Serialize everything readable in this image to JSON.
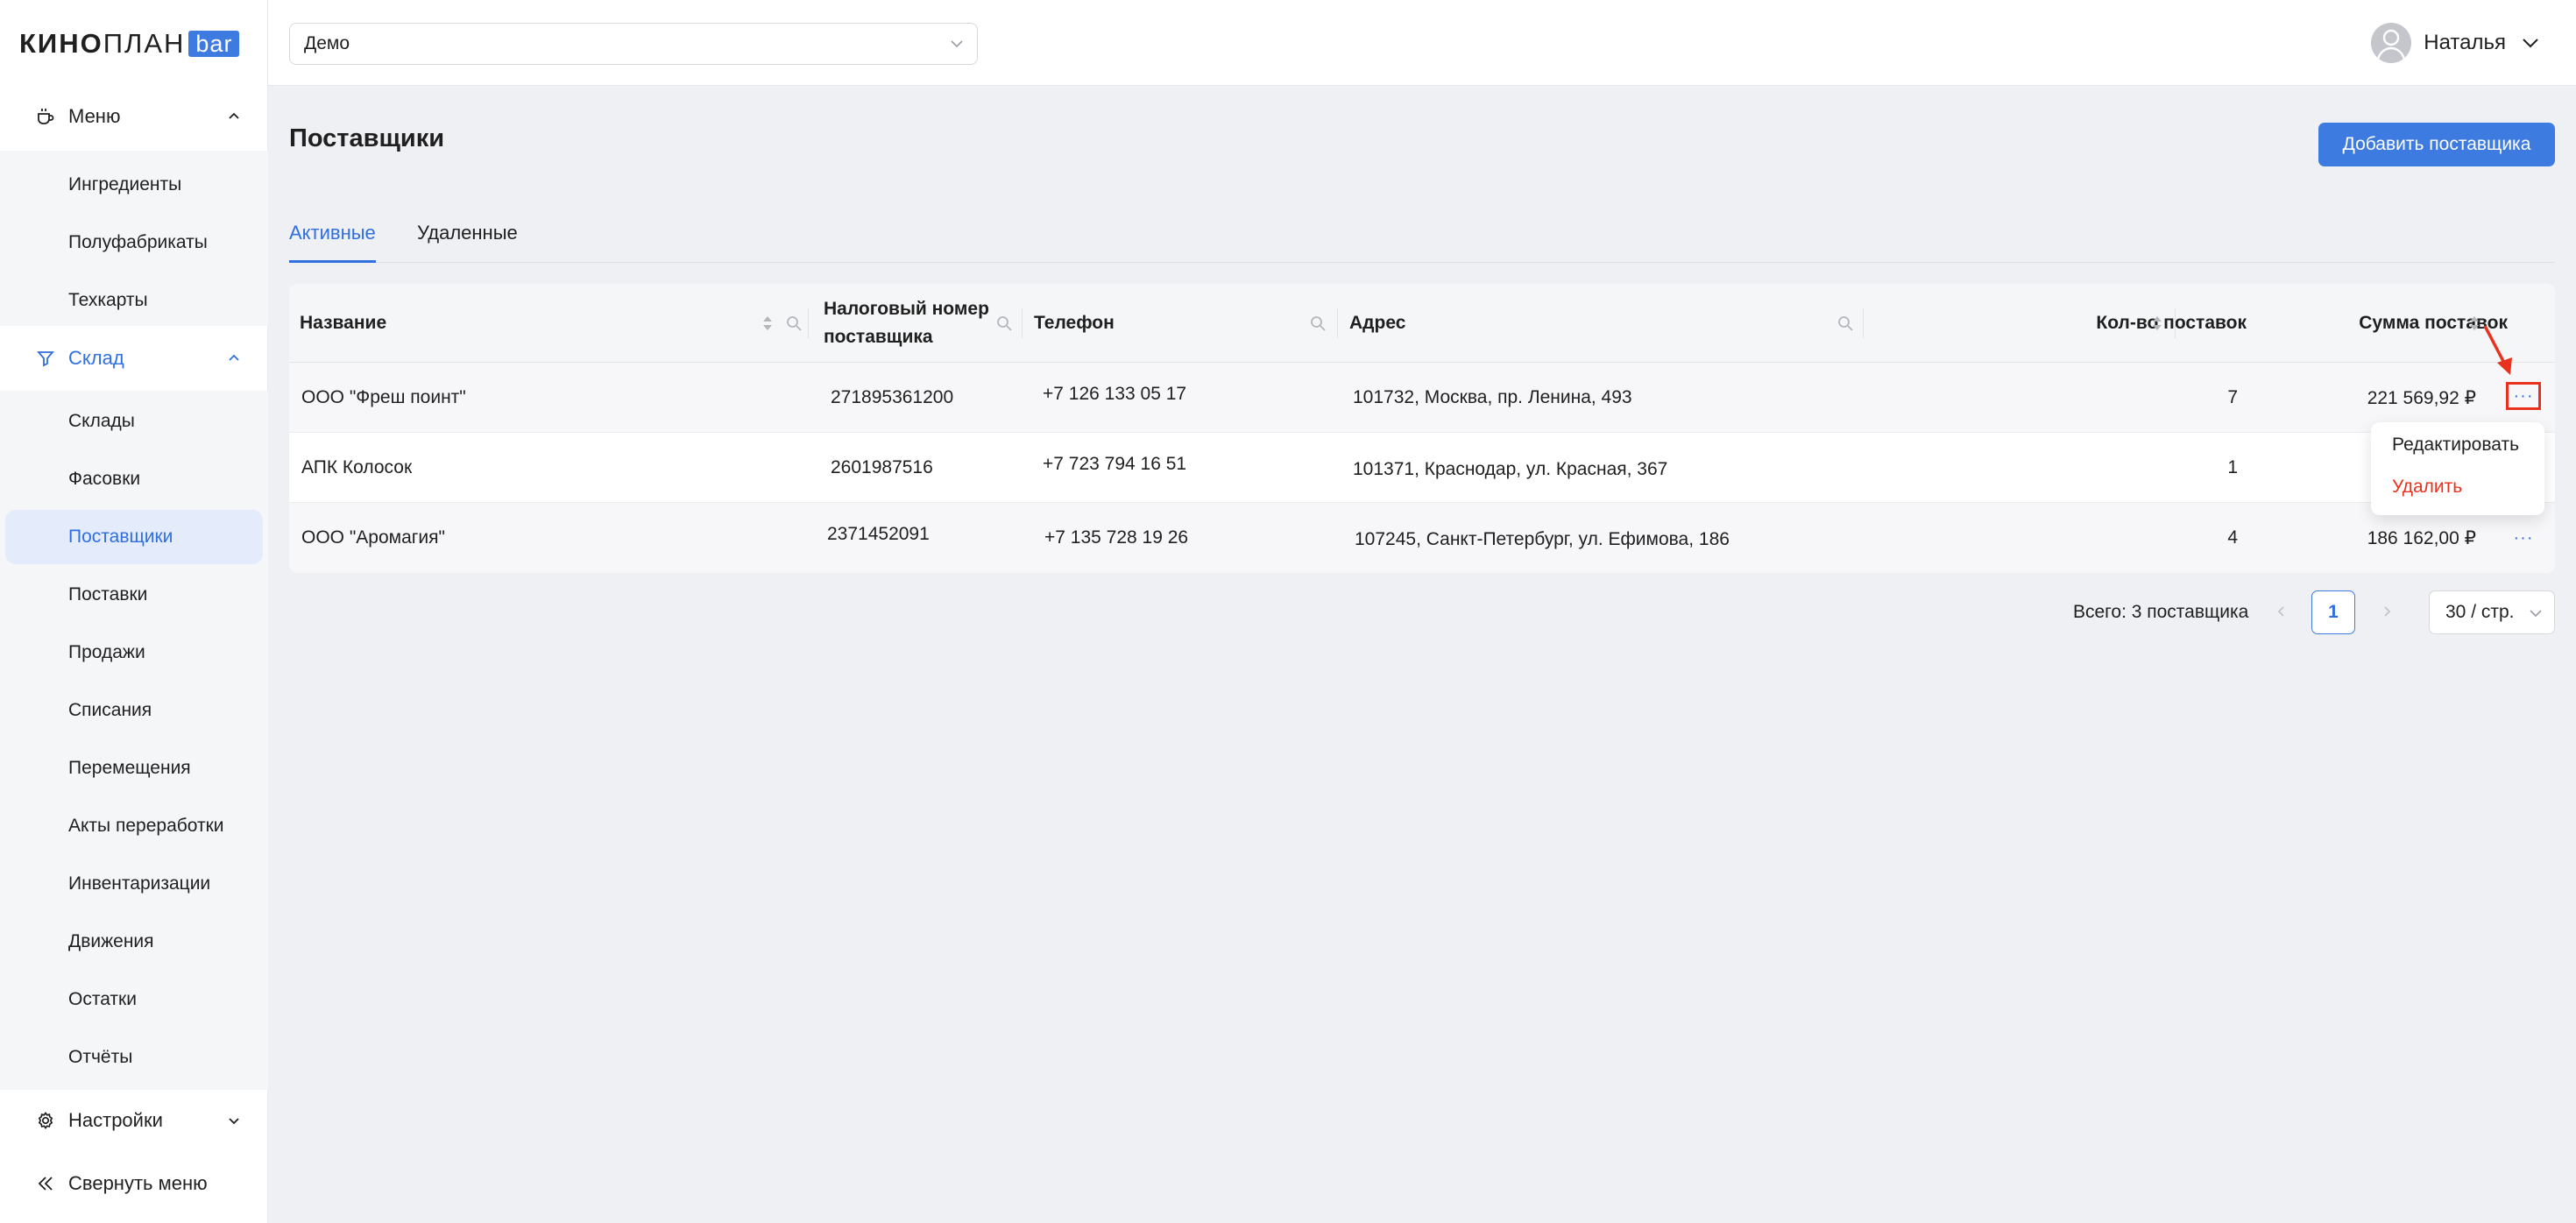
{
  "logo": {
    "kino": "КИНО",
    "plan": "ПЛАН",
    "bar": "bar"
  },
  "org_select": {
    "value": "Демо"
  },
  "user": {
    "name": "Наталья"
  },
  "sidebar": {
    "menu_group": "Меню",
    "menu_items": [
      "Ингредиенты",
      "Полуфабрикаты",
      "Техкарты"
    ],
    "warehouse_group": "Склад",
    "warehouse_items": [
      "Склады",
      "Фасовки",
      "Поставщики",
      "Поставки",
      "Продажи",
      "Списания",
      "Перемещения",
      "Акты переработки",
      "Инвентаризации",
      "Движения",
      "Остатки",
      "Отчёты"
    ],
    "selected_item": "Поставщики",
    "settings": "Настройки",
    "collapse": "Свернуть меню"
  },
  "page": {
    "title": "Поставщики",
    "add_button": "Добавить поставщика",
    "tabs": [
      "Активные",
      "Удаленные"
    ]
  },
  "table": {
    "columns": {
      "name": "Название",
      "tax_line1": "Налоговый номер",
      "tax_line2": "поставщика",
      "phone": "Телефон",
      "address": "Адрес",
      "count": "Кол-во поставок",
      "sum": "Сумма поставок"
    },
    "rows": [
      {
        "name": "ООО \"Фреш поинт\"",
        "tax": "271895361200",
        "phone": "+7 126 133 05 17",
        "address": "101732, Москва, пр. Ленина, 493",
        "count": "7",
        "sum": "221 569,92 ₽"
      },
      {
        "name": "АПК Колосок",
        "tax": "2601987516",
        "phone": "+7 723 794 16 51",
        "address": "101371, Краснодар, ул. Красная, 367",
        "count": "1",
        "sum": ""
      },
      {
        "name": "ООО \"Аромагия\"",
        "tax": "2371452091",
        "phone": "+7 135 728 19 26",
        "address": "107245, Санкт-Петербург, ул. Ефимова, 186",
        "count": "4",
        "sum": "186 162,00 ₽"
      }
    ],
    "row_actions": {
      "more": "···",
      "edit": "Редактировать",
      "delete": "Удалить"
    }
  },
  "pagination": {
    "total": "Всего: 3 поставщика",
    "current_page": "1",
    "per_page": "30 / стр."
  },
  "colors": {
    "accent": "#3d7be0",
    "danger": "#e8321e",
    "background": "#eff0f4"
  },
  "icons": [
    "coffee-icon",
    "funnel-icon",
    "gear-icon",
    "double-chevron-left-icon",
    "chevron-down-icon",
    "chevron-up-icon",
    "search-icon",
    "sort-icon",
    "user-avatar-icon",
    "arrow-icon"
  ]
}
